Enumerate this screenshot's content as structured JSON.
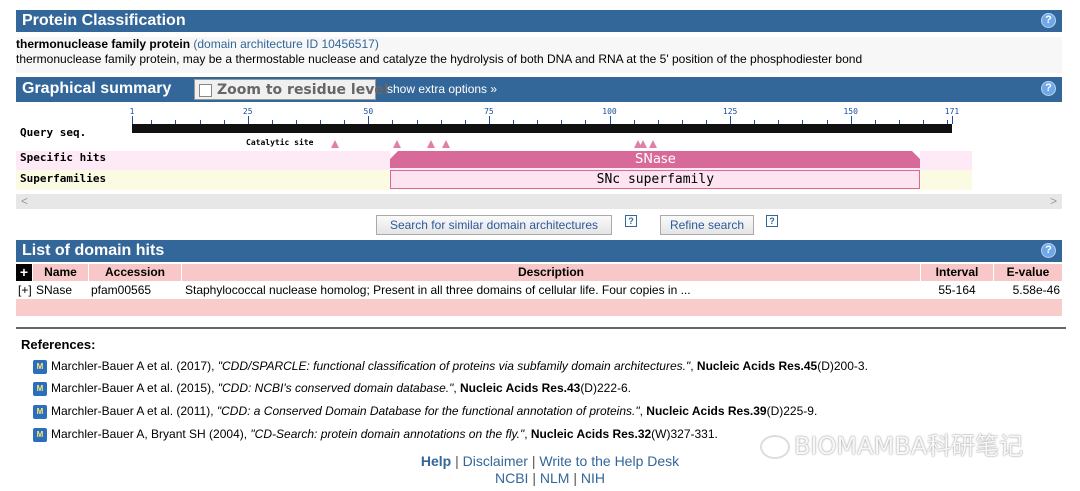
{
  "classification": {
    "title": "Protein Classification",
    "help": "?",
    "name": "thermonuclease family protein",
    "arch_link": "(domain architecture ID 10456517)",
    "description": "thermonuclease family protein, may be a thermostable nuclease and catalyze the hydrolysis of both DNA and RNA at the 5' position of the phosphodiester bond"
  },
  "graphical": {
    "title": "Graphical summary",
    "zoom_label": "Zoom to residue level",
    "extra_options": "show extra options »",
    "help": "?",
    "query_label": "Query seq.",
    "specific_label": "Specific hits",
    "super_label": "Superfamilies",
    "catalytic_label": "Catalytic site",
    "ticks": [
      "1",
      "25",
      "50",
      "75",
      "100",
      "125",
      "150",
      "171"
    ],
    "sequence_length": 171,
    "catalytic_sites": [
      43,
      56,
      63,
      66,
      106,
      107,
      109
    ],
    "specific_hit": {
      "label": "SNase",
      "start": 55,
      "end": 164
    },
    "superfamily": {
      "label": "SNc superfamily",
      "start": 55,
      "end": 164
    },
    "colors": {
      "hit": "#d86a9a",
      "band_specific": "#fdeaf6",
      "band_super": "#fbfbe4"
    }
  },
  "actions": {
    "similar": "Search for similar domain architectures",
    "refine": "Refine search",
    "help": "?"
  },
  "domain_hits": {
    "title": "List of domain hits",
    "help": "?",
    "columns": [
      "Name",
      "Accession",
      "Description",
      "Interval",
      "E-value"
    ],
    "rows": [
      {
        "expand": "[+]",
        "name": "SNase",
        "accession": "pfam00565",
        "description": "Staphylococcal nuclease homolog; Present in all three domains of cellular life. Four copies in ...",
        "interval": "55-164",
        "evalue": "5.58e-46"
      }
    ]
  },
  "references": {
    "title": "References:",
    "items": [
      {
        "authors": "Marchler-Bauer A et al. (2017), ",
        "title": "\"CDD/SPARCLE: functional classification of proteins via subfamily domain architectures.\"",
        "journal": "Nucleic Acids Res.",
        "volume": "45",
        "pages": "(D)200-3."
      },
      {
        "authors": "Marchler-Bauer A et al. (2015), ",
        "title": "\"CDD: NCBI's conserved domain database.\"",
        "journal": "Nucleic Acids Res.",
        "volume": "43",
        "pages": "(D)222-6."
      },
      {
        "authors": "Marchler-Bauer A et al. (2011), ",
        "title": "\"CDD: a Conserved Domain Database for the functional annotation of proteins.\"",
        "journal": "Nucleic Acids Res.",
        "volume": "39",
        "pages": "(D)225-9."
      },
      {
        "authors": "Marchler-Bauer A, Bryant SH (2004), ",
        "title": "\"CD-Search: protein domain annotations on the fly.\"",
        "journal": "Nucleic Acids Res.",
        "volume": "32",
        "pages": "(W)327-331."
      }
    ]
  },
  "footer": {
    "help": "Help",
    "disclaimer": "Disclaimer",
    "write": "Write to the Help Desk",
    "ncbi": "NCBI",
    "nlm": "NLM",
    "nih": "NIH",
    "sep": "|"
  },
  "watermark": "BIOMAMBA科研笔记"
}
